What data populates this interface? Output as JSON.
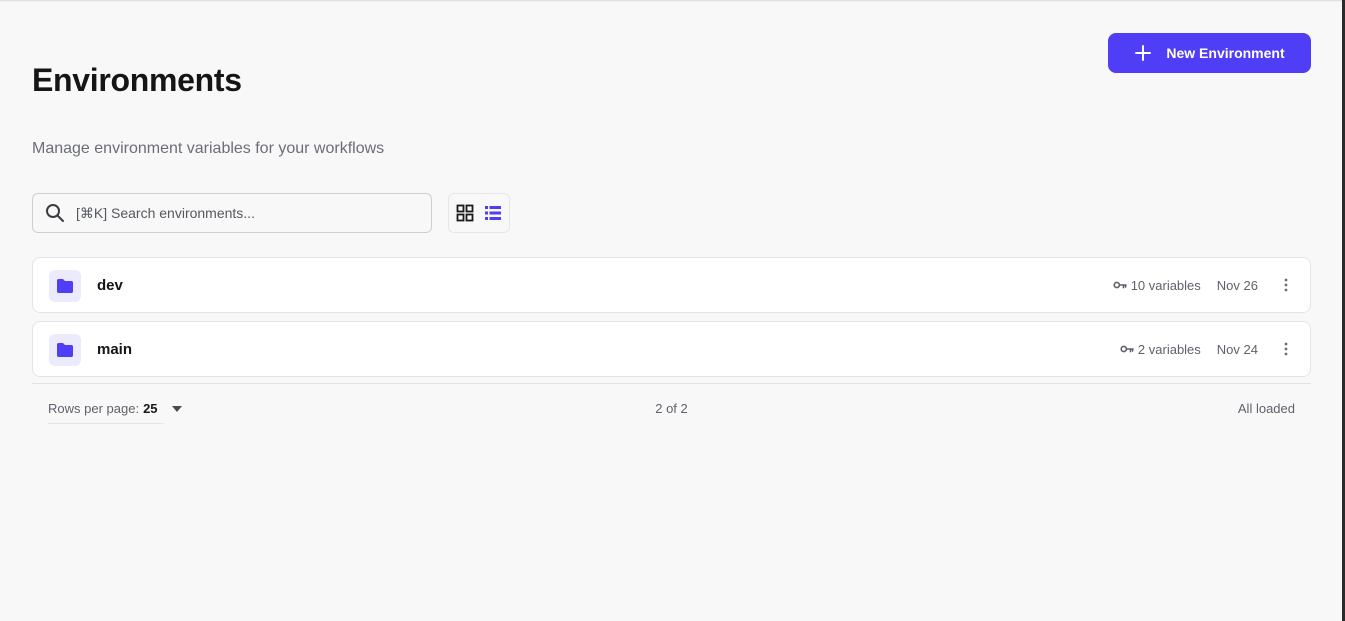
{
  "header": {
    "title": "Environments",
    "subtitle": "Manage environment variables for your workflows",
    "new_button_label": "New Environment"
  },
  "search": {
    "placeholder": "[⌘K] Search environments...",
    "value": ""
  },
  "view_toggle": {
    "options": [
      "grid-view",
      "list-view"
    ],
    "active": "list-view"
  },
  "environments": [
    {
      "name": "dev",
      "variables_label": "10 variables",
      "date": "Nov 26"
    },
    {
      "name": "main",
      "variables_label": "2 variables",
      "date": "Nov 24"
    }
  ],
  "pagination": {
    "rows_per_page_label": "Rows per page:",
    "rows_per_page_value": "25",
    "count_label": "2 of 2",
    "status_label": "All loaded"
  },
  "colors": {
    "accent": "#4f3ef5",
    "background": "#f8f8f8",
    "folder_bg": "#ecebfd"
  }
}
